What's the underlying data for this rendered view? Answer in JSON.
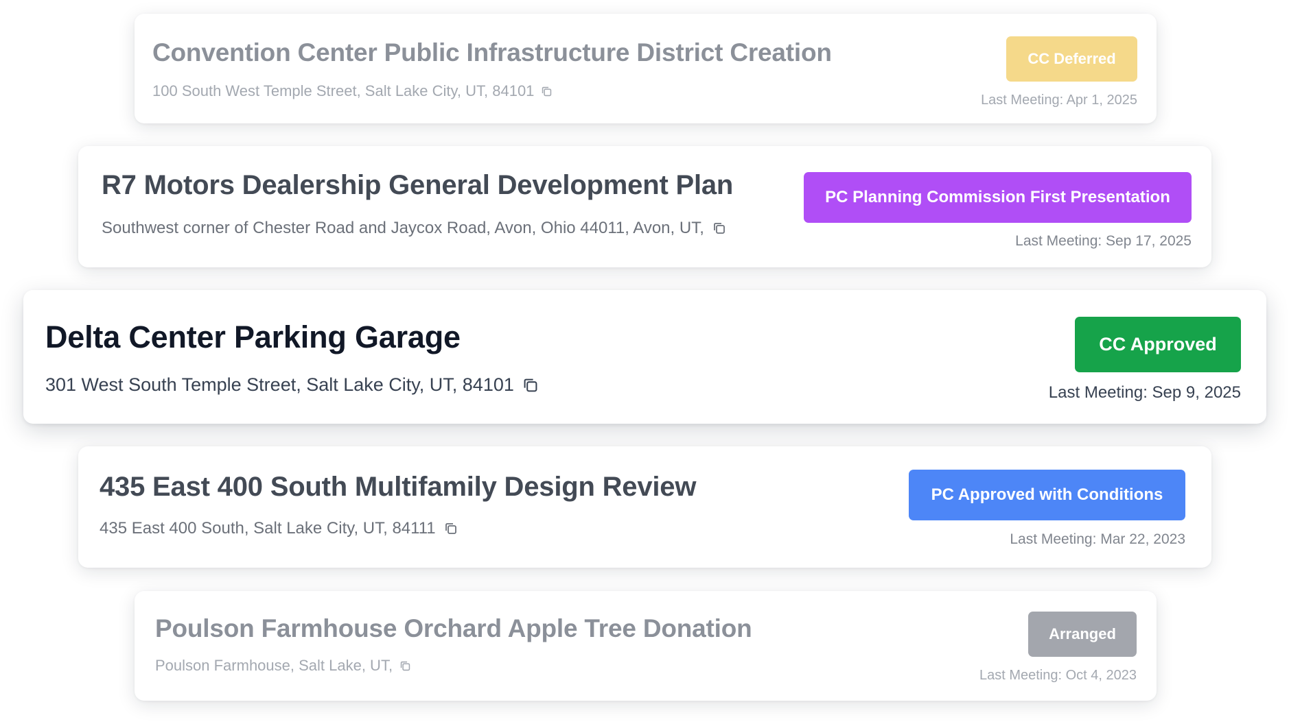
{
  "projects": [
    {
      "title": "Convention Center Public Infrastructure District Creation",
      "address": "100 South West Temple Street, Salt Lake City, UT, 84101",
      "status": "CC Deferred",
      "status_color": "#f5d98a",
      "last_meeting": "Last Meeting: Apr 1, 2025"
    },
    {
      "title": "R7 Motors Dealership General Development Plan",
      "address": "Southwest corner of Chester Road and Jaycox Road, Avon, Ohio 44011, Avon, UT,",
      "status": "PC Planning Commission First Presentation",
      "status_color": "#b04ef6",
      "last_meeting": "Last Meeting: Sep 17, 2025"
    },
    {
      "title": "Delta Center Parking Garage",
      "address": "301 West South Temple Street, Salt Lake City, UT, 84101",
      "status": "CC Approved",
      "status_color": "#16a34a",
      "last_meeting": "Last Meeting: Sep 9, 2025"
    },
    {
      "title": "435 East 400 South Multifamily Design Review",
      "address": "435 East 400 South, Salt Lake City, UT, 84111",
      "status": "PC Approved with Conditions",
      "status_color": "#4d86f7",
      "last_meeting": "Last Meeting: Mar 22, 2023"
    },
    {
      "title": "Poulson Farmhouse Orchard Apple Tree Donation",
      "address": "Poulson Farmhouse, Salt Lake, UT,",
      "status": "Arranged",
      "status_color": "#a3a6ad",
      "last_meeting": "Last Meeting: Oct 4, 2023"
    }
  ],
  "icons": {
    "copy": "copy-icon"
  }
}
